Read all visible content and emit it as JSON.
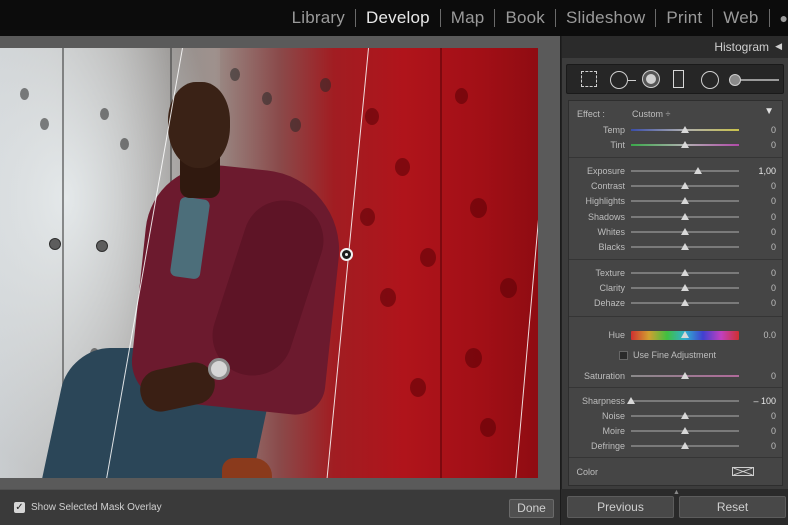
{
  "modules": [
    "Library",
    "Develop",
    "Map",
    "Book",
    "Slideshow",
    "Print",
    "Web"
  ],
  "active_module": "Develop",
  "panel": {
    "title": "Histogram"
  },
  "tools": [
    "crop-overlay-icon",
    "spot-removal-icon",
    "red-eye-icon",
    "graduated-filter-icon",
    "radial-filter-icon",
    "adjustment-brush-icon"
  ],
  "effect": {
    "label": "Effect :",
    "value": "Custom ÷"
  },
  "sliders": {
    "temp": {
      "label": "Temp",
      "value": "0",
      "pos": 0.5
    },
    "tint": {
      "label": "Tint",
      "value": "0",
      "pos": 0.5
    },
    "exposure": {
      "label": "Exposure",
      "value": "1,00",
      "pos": 0.62
    },
    "contrast": {
      "label": "Contrast",
      "value": "0",
      "pos": 0.5
    },
    "highlights": {
      "label": "Highlights",
      "value": "0",
      "pos": 0.5
    },
    "shadows": {
      "label": "Shadows",
      "value": "0",
      "pos": 0.5
    },
    "whites": {
      "label": "Whites",
      "value": "0",
      "pos": 0.5
    },
    "blacks": {
      "label": "Blacks",
      "value": "0",
      "pos": 0.5
    },
    "texture": {
      "label": "Texture",
      "value": "0",
      "pos": 0.5
    },
    "clarity": {
      "label": "Clarity",
      "value": "0",
      "pos": 0.5
    },
    "dehaze": {
      "label": "Dehaze",
      "value": "0",
      "pos": 0.5
    },
    "hue": {
      "label": "Hue",
      "value": "0.0",
      "pos": 0.5
    },
    "saturation": {
      "label": "Saturation",
      "value": "0",
      "pos": 0.5
    },
    "sharpness": {
      "label": "Sharpness",
      "value": "– 100",
      "pos": 0.0
    },
    "noise": {
      "label": "Noise",
      "value": "0",
      "pos": 0.5
    },
    "moire": {
      "label": "Moire",
      "value": "0",
      "pos": 0.5
    },
    "defringe": {
      "label": "Defringe",
      "value": "0",
      "pos": 0.5
    }
  },
  "fine_adjustment": {
    "label": "Use Fine Adjustment",
    "checked": false
  },
  "color": {
    "label": "Color"
  },
  "overlay": {
    "label": "Show Selected Mask Overlay",
    "checked": true,
    "check_glyph": "✓"
  },
  "buttons": {
    "done": "Done",
    "previous": "Previous",
    "reset": "Reset"
  },
  "colors": {
    "accent_active": "#e8e8e8",
    "mask_overlay": "#b0141b"
  }
}
